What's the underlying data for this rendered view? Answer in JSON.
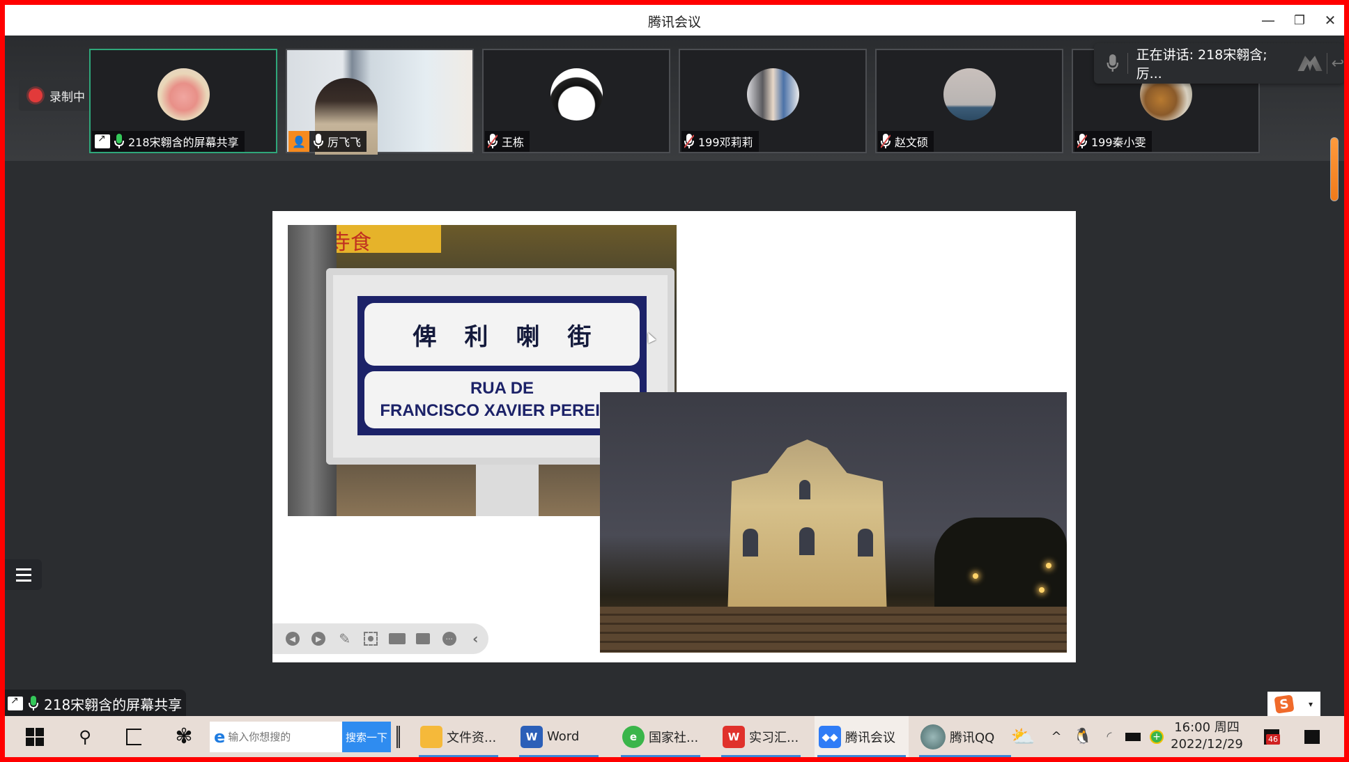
{
  "window": {
    "title": "腾讯会议",
    "controls": [
      "minimize",
      "restore",
      "close"
    ]
  },
  "recording": {
    "label": "录制中"
  },
  "speaking": {
    "label": "正在讲话: 218宋翱含; 厉..."
  },
  "participants": [
    {
      "name": "218宋翱含的屏幕共享",
      "mic": "on",
      "sharing": true,
      "active": true,
      "avatar": "cartoon-avatar"
    },
    {
      "name": "厉飞飞",
      "mic": "on",
      "sharing": false,
      "active": false,
      "avatar": "video-feed",
      "host_badge": true
    },
    {
      "name": "王栋",
      "mic": "muted",
      "sharing": false,
      "active": false,
      "avatar": "anime-avatar"
    },
    {
      "name": "199邓莉莉",
      "mic": "muted",
      "sharing": false,
      "active": false,
      "avatar": "photo-avatar"
    },
    {
      "name": "赵文硕",
      "mic": "muted",
      "sharing": false,
      "active": false,
      "avatar": "moon-avatar"
    },
    {
      "name": "199秦小雯",
      "mic": "muted",
      "sharing": false,
      "active": false,
      "avatar": "photo-avatar"
    }
  ],
  "slide": {
    "sign_chinese": "俾利喇街",
    "sign_line1": "RUA DE",
    "sign_line2": "FRANCISCO XAVIER PEREIRA",
    "shop_sign": "興寺食",
    "photo2_subject": "Ruins of St. Paul's facade at night",
    "toolbar": [
      "previous",
      "next",
      "pen",
      "screenshot",
      "camera",
      "comment",
      "more",
      "collapse"
    ]
  },
  "share_badge": {
    "label": "218宋翱含的屏幕共享"
  },
  "ime": {
    "label": "S"
  },
  "taskbar": {
    "search_placeholder": "输入你想搜的",
    "search_button": "搜索一下",
    "apps": [
      {
        "label": "文件资...",
        "icon": "folder",
        "color": "#f5b93a"
      },
      {
        "label": "Word",
        "icon": "W",
        "color": "#2b5fb8"
      },
      {
        "label": "国家社...",
        "icon": "e",
        "color": "#3ab54a"
      },
      {
        "label": "实习汇...",
        "icon": "W",
        "color": "#e0312b"
      },
      {
        "label": "腾讯会议",
        "icon": "meeting",
        "color": "#2f7cf6",
        "active": true
      },
      {
        "label": "腾讯QQ",
        "icon": "qq",
        "color": "#6f9a9a"
      }
    ],
    "clock_time": "16:00 周四",
    "clock_date": "2022/12/29",
    "notification_count": "46"
  },
  "colors": {
    "frame": "#ff0000",
    "active_border": "#2fa77a",
    "accent_blue": "#2f8cf0",
    "scroll_orange": "#f07a1a",
    "muted_red": "#d94848"
  }
}
